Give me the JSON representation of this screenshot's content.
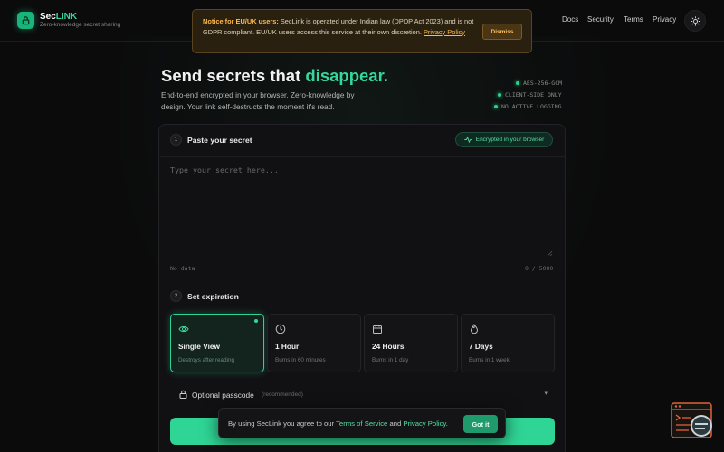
{
  "brand": {
    "name_prefix": "Sec",
    "name_accent": "LINK",
    "tagline": "Zero-knowledge secret sharing"
  },
  "nav": {
    "items": [
      "Docs",
      "Security",
      "Terms",
      "Privacy"
    ]
  },
  "notice": {
    "heading": "Notice for EU/UK users:",
    "body": " SecLink is operated under Indian law (DPDP Act 2023) and is not GDPR compliant. EU/UK users access this service at their own discretion.",
    "link": "Privacy Policy",
    "dismiss_label": "Dismiss"
  },
  "hero": {
    "title_start": "Send secrets that ",
    "title_accent": "disappear.",
    "description": "End-to-end encrypted in your browser. Zero-knowledge by design. Your link self-destructs the moment it's read.",
    "tags": [
      "AES-256-GCM",
      "CLIENT-SIDE ONLY",
      "NO ACTIVE LOGGING"
    ]
  },
  "secret_step": {
    "number": "1",
    "label": "Paste your secret",
    "badge": "Encrypted in your browser",
    "placeholder": "Type your secret here...",
    "status": "No data",
    "counter": "0 / 5000"
  },
  "expiry_step": {
    "number": "2",
    "label": "Set expiration",
    "options": [
      {
        "title": "Single View",
        "subtitle": "Destroys after reading",
        "icon": "eye-icon",
        "selected": true
      },
      {
        "title": "1 Hour",
        "subtitle": "Burns in 60 minutes",
        "icon": "clock-icon",
        "selected": false
      },
      {
        "title": "24 Hours",
        "subtitle": "Burns in 1 day",
        "icon": "calendar-icon",
        "selected": false
      },
      {
        "title": "7 Days",
        "subtitle": "Burns in 1 week",
        "icon": "flame-icon",
        "selected": false
      }
    ]
  },
  "passcode": {
    "label": "Optional passcode",
    "hint": "(recommended)"
  },
  "cookie": {
    "text_start": "By using SecLink you agree to our ",
    "terms_link": "Terms of Service",
    "and": " and ",
    "privacy_link": "Privacy Policy",
    "end": ".",
    "button": "Got it"
  },
  "colors": {
    "accent": "#35d79d",
    "background": "#0b0b0c",
    "notice_accent": "#ffb84a"
  }
}
